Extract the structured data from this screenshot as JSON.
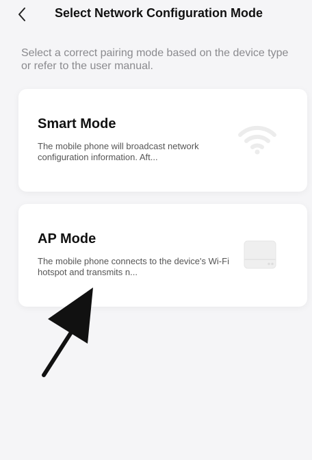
{
  "nav": {
    "back_icon": "chevron-left-icon",
    "title": "Select Network Configuration Mode"
  },
  "subtitle": "Select a correct pairing mode based on the device type or refer to the user manual.",
  "modes": [
    {
      "title": "Smart Mode",
      "description": "The mobile phone will broadcast network configuration information. Aft...",
      "icon": "wifi-icon"
    },
    {
      "title": "AP Mode",
      "description": "The mobile phone connects to the device's Wi-Fi hotspot and transmits n...",
      "icon": "router-icon"
    }
  ],
  "colors": {
    "background": "#f5f5f7",
    "card": "#ffffff",
    "title": "#111111",
    "subtitle": "#8a8a8e",
    "icon": "#ececec",
    "arrow": "#111111"
  }
}
